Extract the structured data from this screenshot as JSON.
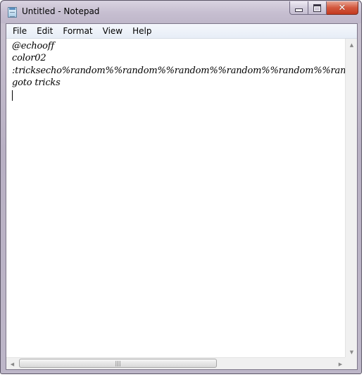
{
  "window": {
    "title": "Untitled - Notepad",
    "icon": "notepad-icon",
    "controls": {
      "minimize_icon": "minimize-icon",
      "maximize_icon": "maximize-icon",
      "close_icon": "close-icon",
      "close_glyph": "✕",
      "close_color": "#c43a1f"
    }
  },
  "menubar": {
    "items": [
      {
        "label": "File"
      },
      {
        "label": "Edit"
      },
      {
        "label": "Format"
      },
      {
        "label": "View"
      },
      {
        "label": "Help"
      }
    ]
  },
  "editor": {
    "lines": [
      "@echooff",
      "color02",
      ":tricksecho%random%%random%%random%%random%%random%%random%",
      "goto tricks"
    ]
  },
  "scrollbars": {
    "vertical": {
      "up_arrow": "▲",
      "down_arrow": "▼"
    },
    "horizontal": {
      "left_arrow": "◀",
      "right_arrow": "▶",
      "thumb_grip": "|||"
    }
  }
}
